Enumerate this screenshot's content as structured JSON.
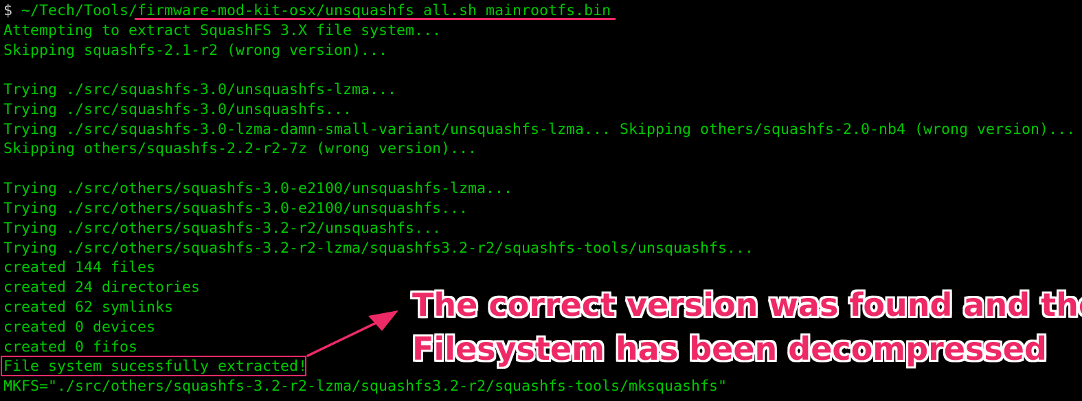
{
  "terminal": {
    "prompt_symbol": "$",
    "command": "~/Tech/Tools/firmware-mod-kit-osx/unsquashfs_all.sh mainrootfs.bin",
    "output_lines": [
      "Attempting to extract SquashFS 3.X file system...",
      "Skipping squashfs-2.1-r2 (wrong version)...",
      "",
      "Trying ./src/squashfs-3.0/unsquashfs-lzma...",
      "Trying ./src/squashfs-3.0/unsquashfs...",
      "Trying ./src/squashfs-3.0-lzma-damn-small-variant/unsquashfs-lzma... Skipping others/squashfs-2.0-nb4 (wrong version)...",
      "Skipping others/squashfs-2.2-r2-7z (wrong version)...",
      "",
      "Trying ./src/others/squashfs-3.0-e2100/unsquashfs-lzma...",
      "Trying ./src/others/squashfs-3.0-e2100/unsquashfs...",
      "Trying ./src/others/squashfs-3.2-r2/unsquashfs...",
      "Trying ./src/others/squashfs-3.2-r2-lzma/squashfs3.2-r2/squashfs-tools/unsquashfs...",
      "created 144 files",
      "created 24 directories",
      "created 62 symlinks",
      "created 0 devices",
      "created 0 fifos",
      "File system sucessfully extracted!",
      "MKFS=\"./src/others/squashfs-3.2-r2-lzma/squashfs3.2-r2/squashfs-tools/mksquashfs\""
    ]
  },
  "annotation": {
    "line1": "The correct version was found and the",
    "line2": "Filesystem has been decompressed"
  },
  "colors": {
    "background": "#000000",
    "terminal_text": "#00c800",
    "prompt": "#cfcfcf",
    "annotation_accent": "#ee2a66",
    "annotation_outline": "#ffffff"
  }
}
